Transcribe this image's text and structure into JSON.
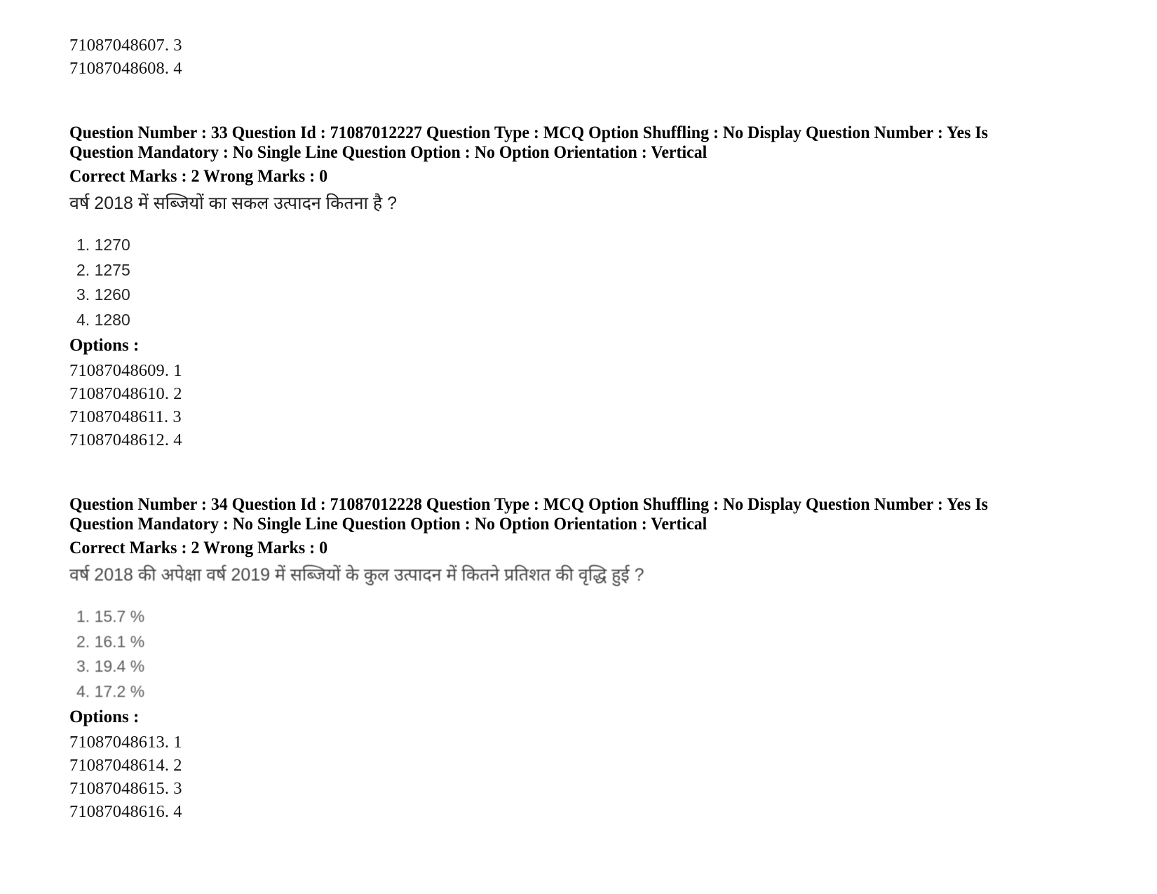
{
  "document": {
    "type": "exam-question-paper",
    "page_background": "#ffffff",
    "text_color": "#000000"
  },
  "top_option_ids": [
    "71087048607. 3",
    "71087048608. 4"
  ],
  "questions": [
    {
      "meta_line1": "Question Number : 33 Question Id : 71087012227 Question Type : MCQ Option Shuffling : No Display Question Number : Yes Is",
      "meta_line2": "Question Mandatory : No Single Line Question Option : No Option Orientation : Vertical",
      "marks_line": "Correct Marks : 2 Wrong Marks : 0",
      "stem": "वर्ष 2018 में सब्जियों का सकल उत्पादन कितना है ?",
      "choices": [
        "1. 1270",
        "2. 1275",
        "3. 1260",
        "4. 1280"
      ],
      "options_label": "Options :",
      "option_ids": [
        "71087048609. 1",
        "71087048610. 2",
        "71087048611. 3",
        "71087048612. 4"
      ]
    },
    {
      "meta_line1": "Question Number : 34 Question Id : 71087012228 Question Type : MCQ Option Shuffling : No Display Question Number : Yes Is",
      "meta_line2": "Question Mandatory : No Single Line Question Option : No Option Orientation : Vertical",
      "marks_line": "Correct Marks : 2 Wrong Marks : 0",
      "stem": "वर्ष 2018 की अपेक्षा वर्ष 2019 में सब्जियों के कुल उत्पादन में कितने प्रतिशत की वृद्धि हुई ?",
      "choices": [
        "1. 15.7 %",
        "2. 16.1 %",
        "3. 19.4 %",
        "4. 17.2 %"
      ],
      "options_label": "Options :",
      "option_ids": [
        "71087048613. 1",
        "71087048614. 2",
        "71087048615. 3",
        "71087048616. 4"
      ]
    }
  ]
}
